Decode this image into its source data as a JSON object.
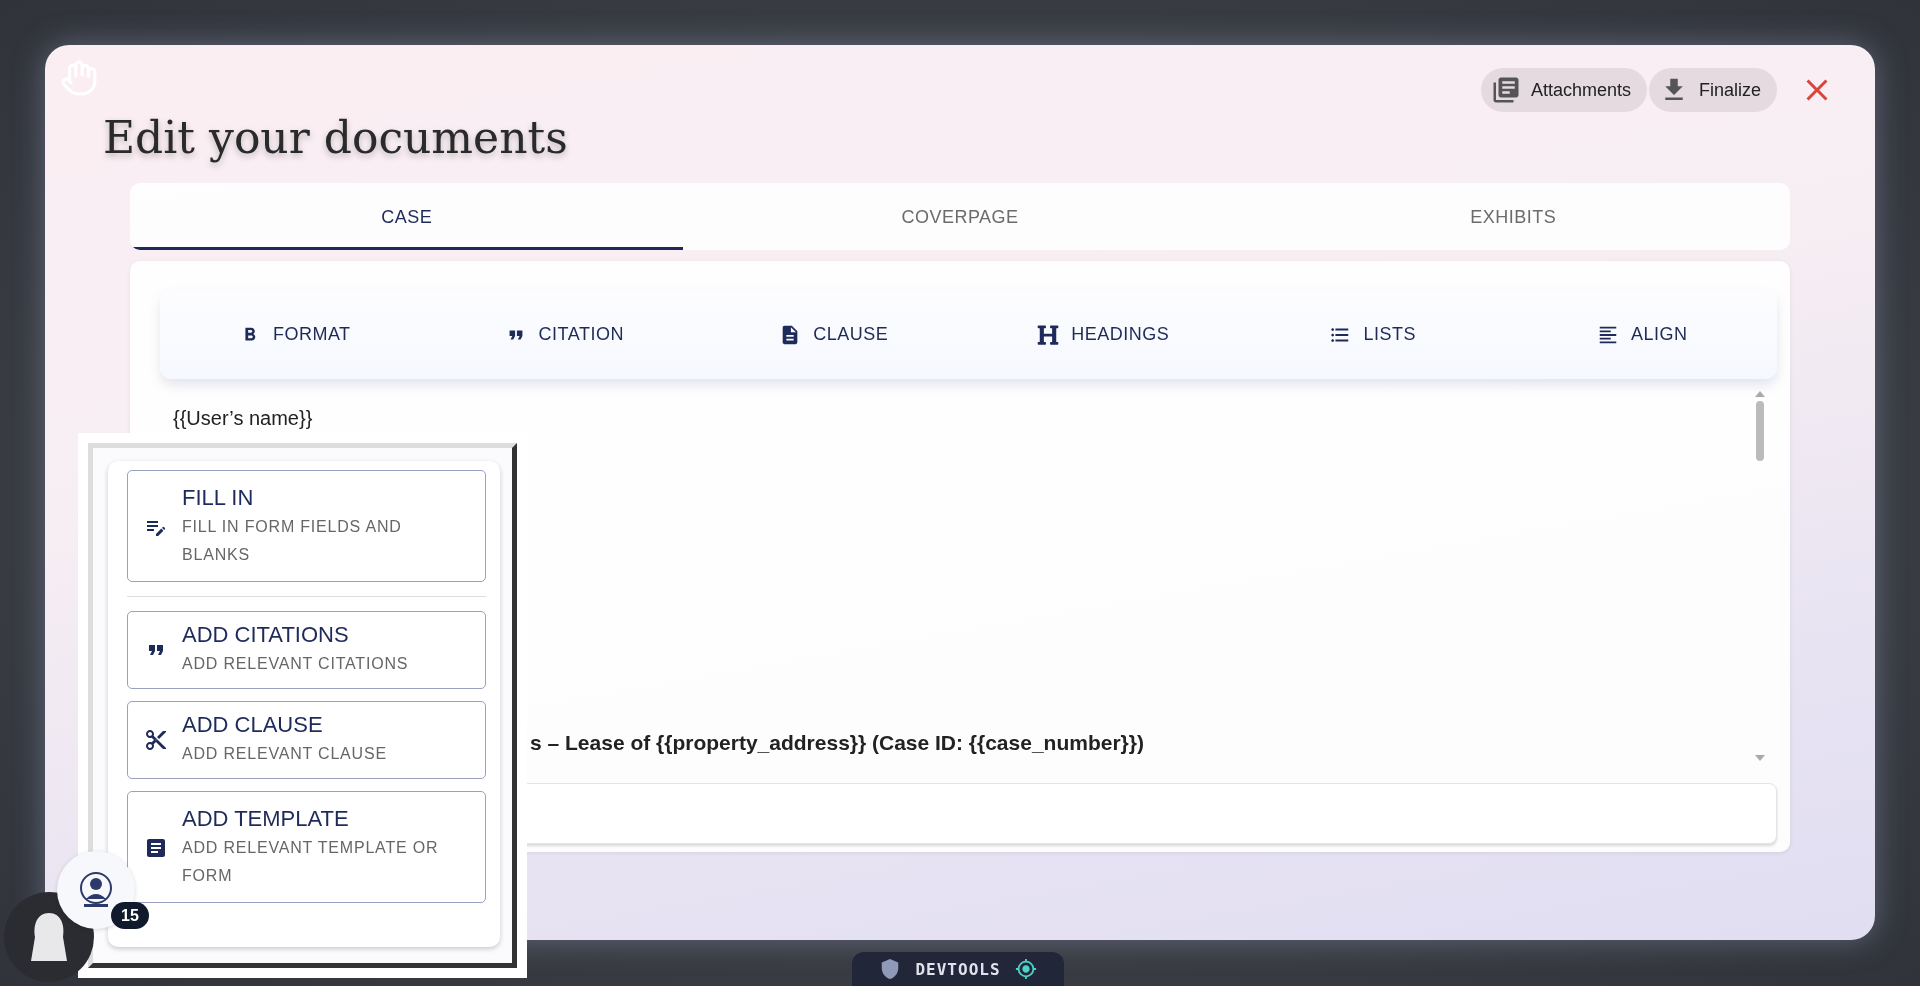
{
  "window": {
    "title": "Edit your documents"
  },
  "header_actions": [
    {
      "label": "Attachments",
      "kind": "attachments"
    },
    {
      "label": "Finalize",
      "kind": "finalize"
    }
  ],
  "tabs": [
    {
      "label": "CASE",
      "selected": true
    },
    {
      "label": "COVERPAGE",
      "selected": false
    },
    {
      "label": "EXHIBITS",
      "selected": false
    }
  ],
  "toolbar": [
    {
      "label": "FORMAT",
      "kind": "bold"
    },
    {
      "label": "CITATION",
      "kind": "quote"
    },
    {
      "label": "CLAUSE",
      "kind": "file"
    },
    {
      "label": "HEADINGS",
      "kind": "heading"
    },
    {
      "label": "LISTS",
      "kind": "list"
    },
    {
      "label": "ALIGN",
      "kind": "align"
    }
  ],
  "editor": {
    "lines": [
      {
        "text": "{{User’s name}}",
        "kind": "plain"
      },
      {
        "text": "s – Lease of {{property_address}} (Case ID: {{case_number}})",
        "kind": "heading"
      }
    ]
  },
  "popup": {
    "items": [
      {
        "title": "FILL IN",
        "subtitle": "FILL IN FORM FIELDS AND BLANKS",
        "kind": "fill"
      },
      {
        "title": "ADD CITATIONS",
        "subtitle": "ADD RELEVANT CITATIONS",
        "kind": "citation"
      },
      {
        "title": "ADD CLAUSE",
        "subtitle": "ADD RELEVANT CLAUSE",
        "kind": "clause"
      },
      {
        "title": "ADD TEMPLATE",
        "subtitle": "ADD RELEVANT TEMPLATE OR FORM",
        "kind": "template"
      }
    ]
  },
  "assistant": {
    "badge": "15"
  },
  "devtools": {
    "label": "DEVTOOLS"
  }
}
